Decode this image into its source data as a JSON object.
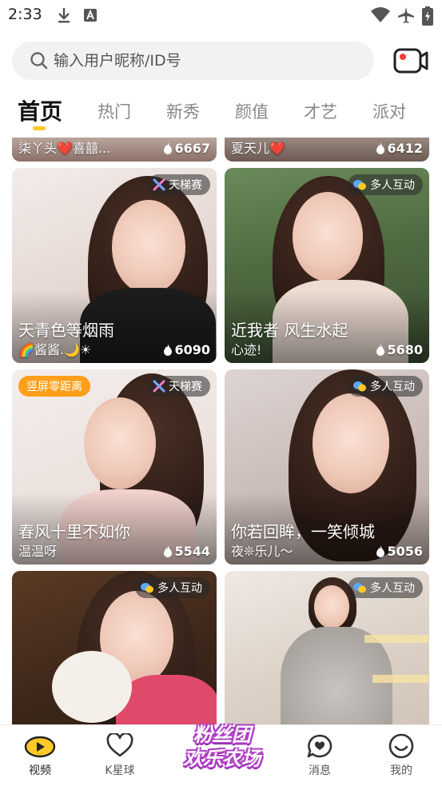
{
  "status": {
    "time": "2:33"
  },
  "search": {
    "placeholder": "输入用户昵称/ID号"
  },
  "tabs": [
    {
      "label": "首页",
      "active": true
    },
    {
      "label": "热门"
    },
    {
      "label": "新秀"
    },
    {
      "label": "颜值"
    },
    {
      "label": "才艺"
    },
    {
      "label": "派对"
    }
  ],
  "partial_row": [
    {
      "title": "柒丫头❤️喜囍...",
      "count": "6667"
    },
    {
      "title": "夏天儿❤️",
      "count": "6412"
    }
  ],
  "cards": [
    {
      "title": "天青色等烟雨",
      "subtitle": "🌈酱酱.🌙☀",
      "count": "6090",
      "badge": "天梯赛",
      "badge_left": ""
    },
    {
      "title": "近我者 风生水起",
      "subtitle": "心迹!",
      "count": "5680",
      "badge": "多人互动",
      "badge_left": ""
    },
    {
      "title": "春风十里不如你",
      "subtitle": "温温呀",
      "count": "5544",
      "badge": "天梯赛",
      "badge_left": "竖屏零距离"
    },
    {
      "title": "你若回眸，一笑倾城",
      "subtitle": "夜❊乐儿～",
      "count": "5056",
      "badge": "多人互动",
      "badge_left": ""
    },
    {
      "title": "",
      "subtitle": "",
      "count": "",
      "badge": "多人互动",
      "badge_left": ""
    },
    {
      "title": "",
      "subtitle": "",
      "count": "",
      "badge": "多人互动",
      "badge_left": ""
    }
  ],
  "nav": {
    "video": "视频",
    "kstar": "K星球",
    "center_line1": "粉丝团",
    "center_line2": "欢乐农场",
    "messages": "消息",
    "mine": "我的"
  },
  "colors": {
    "accent": "#ffc928",
    "badge_orange": "#ff9f1a",
    "live_red": "#ff3b3b"
  }
}
